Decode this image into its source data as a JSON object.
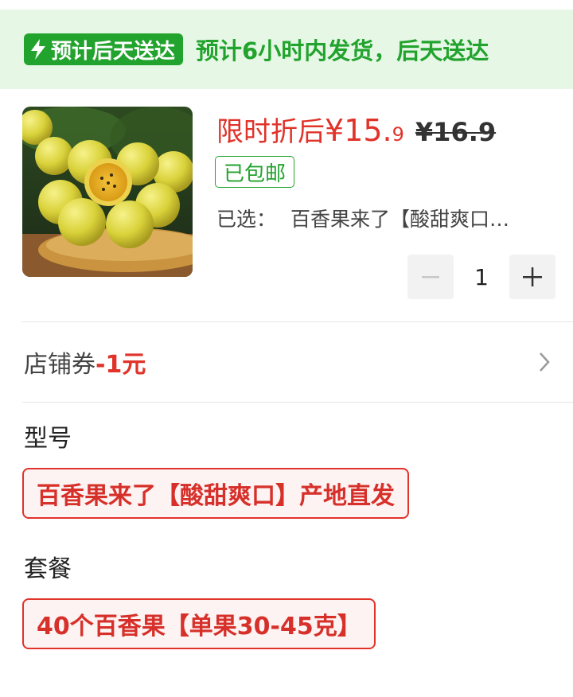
{
  "delivery": {
    "tag_label": "预计后天送达",
    "tag_icon": "lightning-icon",
    "message": "预计6小时内发货，后天送达",
    "accent_color": "#22a32d"
  },
  "product": {
    "image_alt": "passion fruit on a woven tray",
    "price_label": "限时折后",
    "price_currency": "¥",
    "price_integer": "15.",
    "price_decimal": "9",
    "original_price": "¥16.9",
    "shipping_badge": "已包邮",
    "selected_label": "已选：",
    "selected_value": "百香果来了【酸甜爽口…",
    "quantity": "1",
    "price_color": "#e0332a"
  },
  "coupon": {
    "label": "店铺券",
    "value": "-1元"
  },
  "options": {
    "model_title": "型号",
    "model_value": "百香果来了【酸甜爽口】产地直发",
    "package_title": "套餐",
    "package_value": "40个百香果【单果30-45克】"
  }
}
